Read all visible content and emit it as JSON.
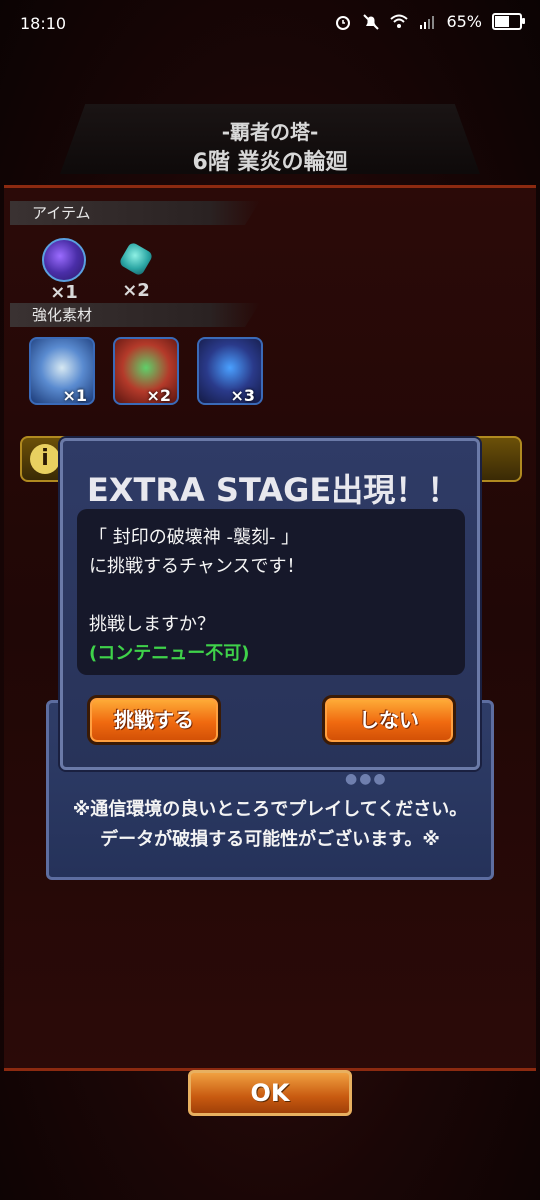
{
  "status_bar": {
    "time": "18:10",
    "battery": "65%",
    "battery_level": 0.65
  },
  "header": {
    "tower_name": "-覇者の塔-",
    "floor_title": "6階 業炎の輪廻"
  },
  "items_section": {
    "label": "アイテム",
    "items": [
      {
        "icon": "purple-gem-icon",
        "count": "×1"
      },
      {
        "icon": "teal-gem-icon",
        "count": "×2"
      }
    ]
  },
  "materials_section": {
    "label": "強化素材",
    "materials": [
      {
        "icon": "blue-monster-icon",
        "count": "×1"
      },
      {
        "icon": "green-monster-icon",
        "count": "×2"
      },
      {
        "icon": "dark-blue-monster-icon",
        "count": "×3"
      }
    ]
  },
  "info": {
    "icon": "i"
  },
  "dialog": {
    "title": "EXTRA STAGE出現！！",
    "line1": "「 封印の破壊神 -襲刻- 」",
    "line2": "に挑戦するチャンスです！",
    "line3": "挑戦しますか？",
    "line4": "(コンテニュー不可)",
    "challenge_button": "挑戦する",
    "decline_button": "しない"
  },
  "notice": {
    "line1": "※通信環境の良いところでプレイしてください。",
    "line2": "データが破損する可能性がございます。※"
  },
  "ok_button": "OK",
  "colors": {
    "accent_orange": "#f06a10",
    "green_text": "#3fd24a",
    "dialog_bg": "#2f3b66"
  }
}
